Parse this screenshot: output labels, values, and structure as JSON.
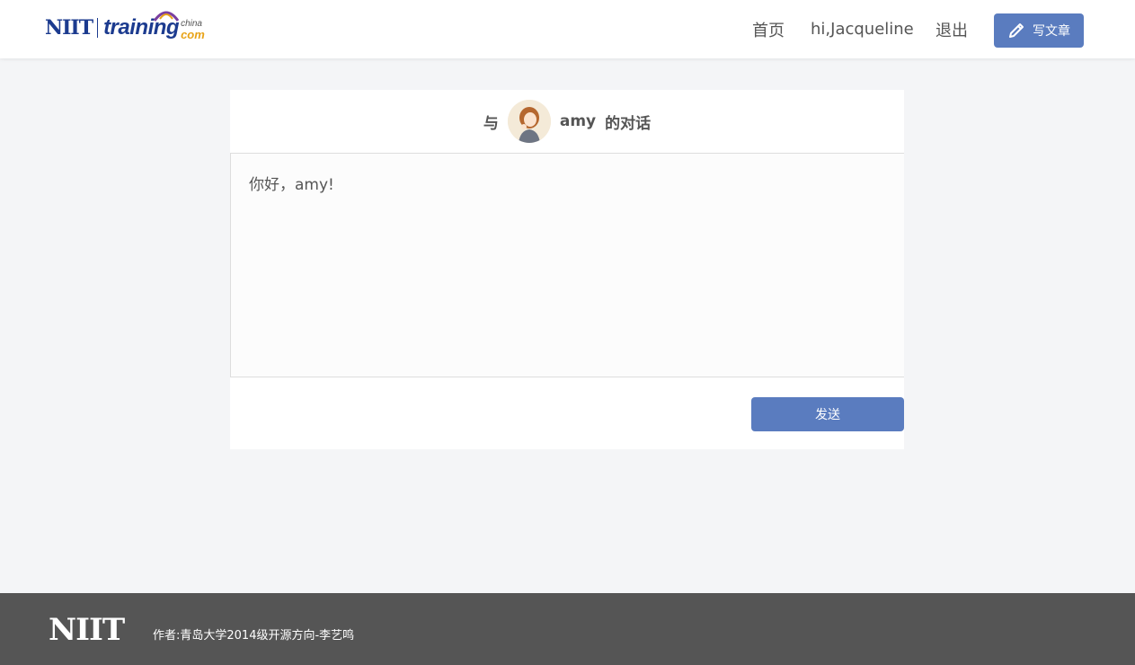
{
  "header": {
    "logo": {
      "part1": "NIIT",
      "part2": "training",
      "part3": "china",
      "part4": "com"
    },
    "nav": {
      "home": "首页",
      "user": "hi,Jacqueline",
      "logout": "退出"
    },
    "write_button": {
      "label": "写文章",
      "icon": "pencil-icon"
    }
  },
  "conversation": {
    "prefix": "与",
    "partner": "amy",
    "suffix": "的对话",
    "message": "你好，amy!",
    "send_label": "发送"
  },
  "footer": {
    "logo": "NIIT",
    "author": "作者:青岛大学2014级开源方向-李艺鸣"
  },
  "colors": {
    "accent": "#5a7cbf",
    "brand": "#1c3b8f",
    "footer_bg": "#555555",
    "page_bg": "#f4f5f7"
  }
}
